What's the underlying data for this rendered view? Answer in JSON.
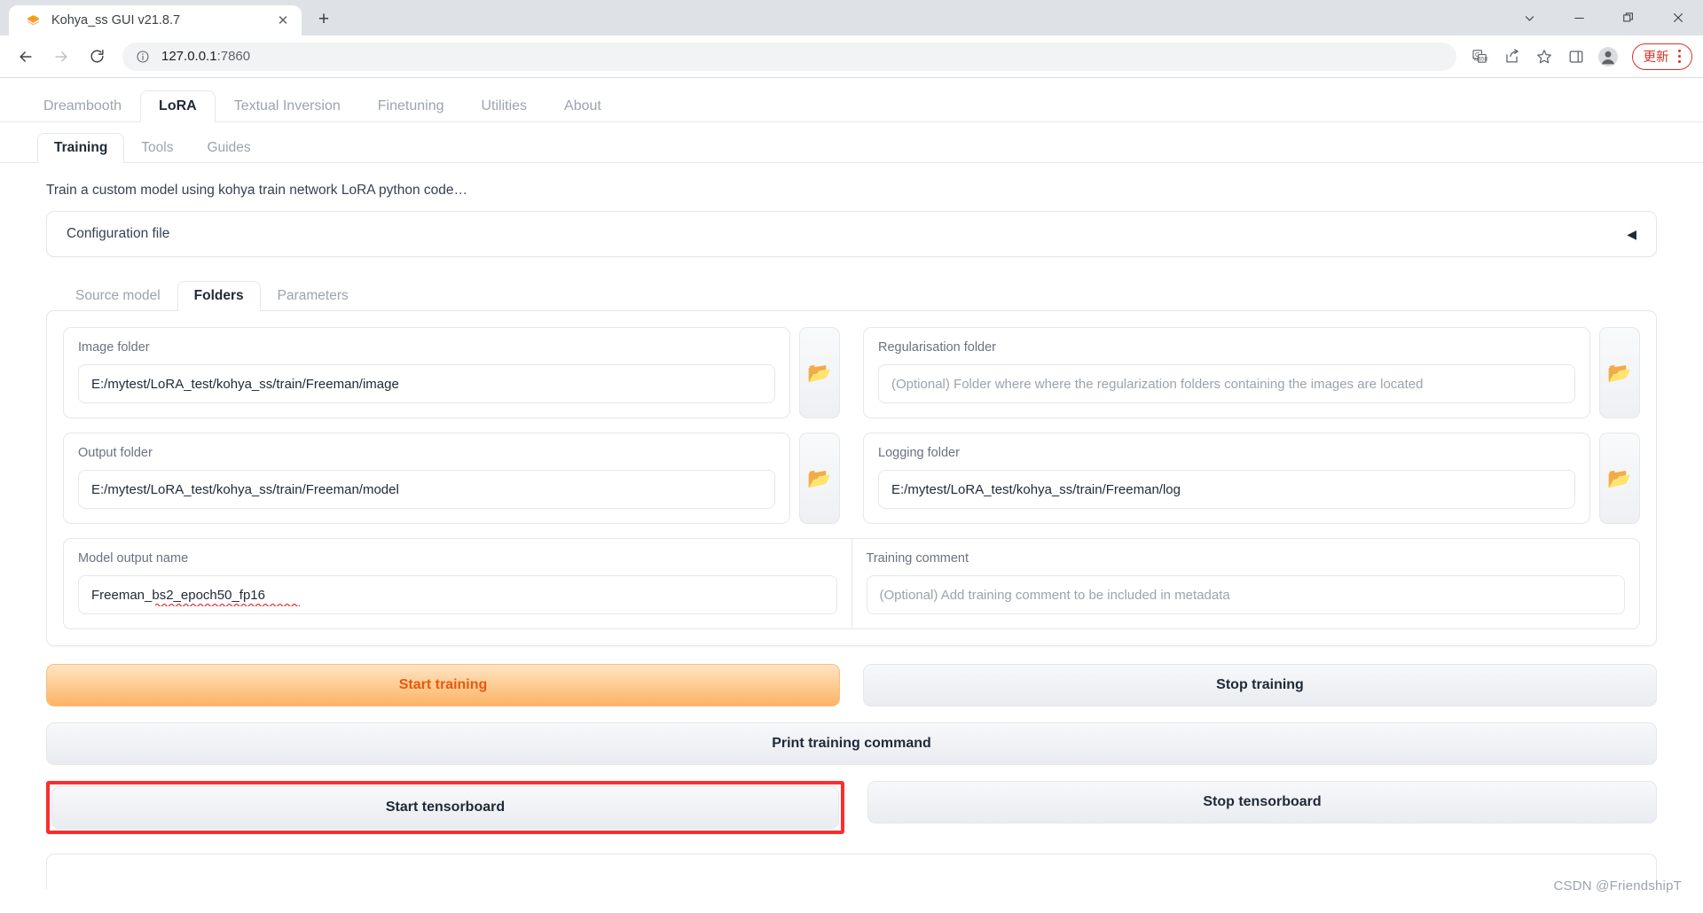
{
  "browser": {
    "tab": {
      "title": "Kohya_ss GUI v21.8.7",
      "favicon_icon": "gradio-layers-icon",
      "close_icon": "close-icon",
      "close_glyph": "✕"
    },
    "new_tab_icon": "plus-icon",
    "new_tab_glyph": "+",
    "window_controls": [
      {
        "name": "tab-search-button",
        "icon": "chevron-down-icon"
      },
      {
        "name": "minimize-button",
        "icon": "minimize-icon"
      },
      {
        "name": "maximize-restore-button",
        "icon": "restore-icon"
      },
      {
        "name": "close-window-button",
        "icon": "close-icon"
      }
    ],
    "toolbar": {
      "back_icon": "back-arrow-icon",
      "forward_icon": "forward-arrow-icon",
      "reload_icon": "reload-icon",
      "info_icon": "info-circle-icon",
      "url": "127.0.0.1:7860",
      "url_host": "127.0.0.1",
      "url_port": ":7860",
      "translate_icon": "translate-icon",
      "share_icon": "share-icon",
      "bookmark_icon": "star-icon",
      "sidepanel_icon": "side-panel-icon",
      "profile_icon": "avatar-icon",
      "update_label": "更新",
      "menu_icon": "kebab-menu-icon",
      "accent_red": "#d93025"
    }
  },
  "app": {
    "main_tabs": [
      {
        "label": "Dreambooth",
        "active": false
      },
      {
        "label": "LoRA",
        "active": true
      },
      {
        "label": "Textual Inversion",
        "active": false
      },
      {
        "label": "Finetuning",
        "active": false
      },
      {
        "label": "Utilities",
        "active": false
      },
      {
        "label": "About",
        "active": false
      }
    ],
    "sub_tabs": [
      {
        "label": "Training",
        "active": true
      },
      {
        "label": "Tools",
        "active": false
      },
      {
        "label": "Guides",
        "active": false
      }
    ],
    "intro_text": "Train a custom model using kohya train network LoRA python code…",
    "accordion": {
      "label": "Configuration file",
      "arrow_glyph": "◀",
      "arrow_icon": "collapse-left-arrow-icon"
    },
    "folder_tabs": [
      {
        "label": "Source model",
        "active": false
      },
      {
        "label": "Folders",
        "active": true
      },
      {
        "label": "Parameters",
        "active": false
      }
    ],
    "fields": {
      "image_folder": {
        "label": "Image folder",
        "value": "E:/mytest/LoRA_test/kohya_ss/train/Freeman/image",
        "placeholder": ""
      },
      "regularisation_folder": {
        "label": "Regularisation folder",
        "value": "",
        "placeholder": "(Optional) Folder where where the regularization folders containing the images are located"
      },
      "output_folder": {
        "label": "Output folder",
        "value": "E:/mytest/LoRA_test/kohya_ss/train/Freeman/model",
        "placeholder": ""
      },
      "logging_folder": {
        "label": "Logging folder",
        "value": "E:/mytest/LoRA_test/kohya_ss/train/Freeman/log",
        "placeholder": ""
      },
      "model_output_name": {
        "label": "Model output name",
        "value": "Freeman_bs2_epoch50_fp16",
        "placeholder": ""
      },
      "training_comment": {
        "label": "Training comment",
        "value": "",
        "placeholder": "(Optional) Add training comment to be included in metadata"
      }
    },
    "folder_picker_icon": "open-folder-icon",
    "folder_picker_glyph": "📂",
    "buttons": {
      "start_training": "Start training",
      "stop_training": "Stop training",
      "print_training_command": "Print training command",
      "start_tensorboard": "Start tensorboard",
      "stop_tensorboard": "Stop tensorboard"
    },
    "highlight": {
      "target": "start-tensorboard-button",
      "color": "#fc2d2d"
    },
    "watermark": "CSDN @FriendshipT"
  }
}
